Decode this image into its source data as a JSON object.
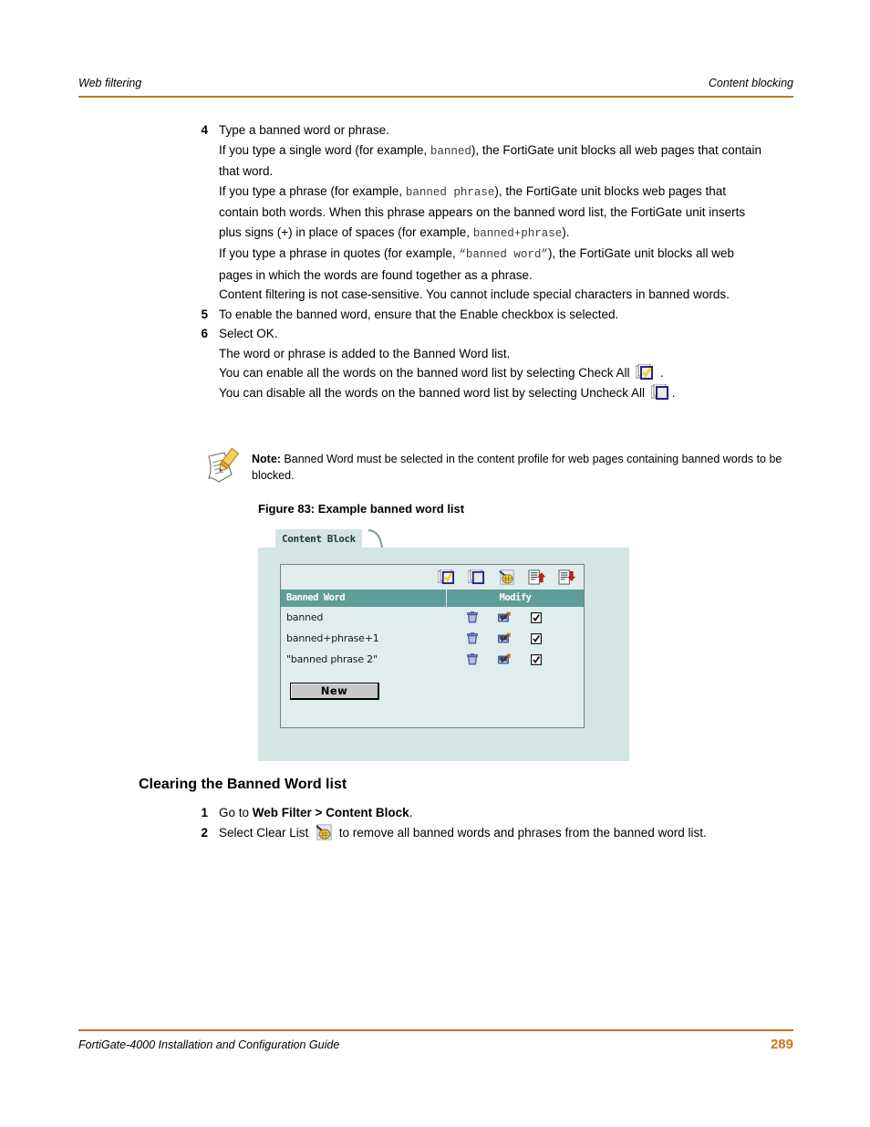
{
  "runhead": {
    "left": "Web filtering",
    "right": "Content blocking",
    "rule_color": "#c4781c"
  },
  "steps": [
    {
      "num": "4",
      "lines": [
        {
          "parts": [
            {
              "t": "Type a banned word or phrase.",
              "s": "plain"
            }
          ]
        },
        {
          "parts": [
            {
              "t": "If you type a single word (for example, ",
              "s": "plain"
            },
            {
              "t": "banned",
              "s": "mono"
            },
            {
              "t": "), the FortiGate unit blocks all web pages that contain that word.",
              "s": "plain"
            }
          ]
        },
        {
          "parts": [
            {
              "t": "If you type a phrase (for example, ",
              "s": "plain"
            },
            {
              "t": "banned phrase",
              "s": "mono"
            },
            {
              "t": "), the FortiGate unit blocks web pages that contain both words. When this phrase appears on the banned word list, the FortiGate unit inserts plus signs (+) in place of spaces (for example, ",
              "s": "plain"
            },
            {
              "t": "banned+phrase",
              "s": "mono"
            },
            {
              "t": ").",
              "s": "plain"
            }
          ]
        },
        {
          "parts": [
            {
              "t": "If you type a phrase in quotes (for example, ",
              "s": "plain"
            },
            {
              "t": "“banned word”",
              "s": "mono"
            },
            {
              "t": "), the FortiGate unit blocks all web pages in which the words are found together as a phrase.",
              "s": "plain"
            }
          ]
        },
        {
          "parts": [
            {
              "t": "Content filtering is not case-sensitive. You cannot include special characters in banned words.",
              "s": "plain"
            }
          ]
        }
      ]
    },
    {
      "num": "5",
      "lines": [
        {
          "parts": [
            {
              "t": "To enable the banned word, ensure that the Enable checkbox is selected.",
              "s": "plain"
            }
          ]
        }
      ]
    },
    {
      "num": "6",
      "lines": [
        {
          "parts": [
            {
              "t": "Select OK.",
              "s": "plain"
            }
          ]
        },
        {
          "parts": [
            {
              "t": "The word or phrase is added to the Banned Word list.",
              "s": "plain"
            }
          ]
        },
        {
          "parts": [
            {
              "t": "You can enable all the words on the banned word list by selecting Check All ",
              "s": "plain"
            },
            {
              "t": "",
              "s": "icon",
              "icon": "check-all-icon"
            },
            {
              "t": " .",
              "s": "plain"
            }
          ]
        },
        {
          "parts": [
            {
              "t": "You can disable all the words on the banned word list by selecting Uncheck All ",
              "s": "plain"
            },
            {
              "t": "",
              "s": "icon",
              "icon": "uncheck-all-icon"
            },
            {
              "t": ".",
              "s": "plain"
            }
          ]
        }
      ]
    }
  ],
  "note": {
    "icon": "note-pencil-icon",
    "label": "Note:",
    "text": " Banned Word must be selected in the content profile for web pages containing banned words to be blocked."
  },
  "figure": {
    "caption": "Figure 83: Example banned word list",
    "tab_label": "Content Block",
    "toolbar_icons": [
      "check-all-icon",
      "uncheck-all-icon",
      "clear-list-icon",
      "upload-list-icon",
      "download-list-icon"
    ],
    "columns": [
      "Banned Word",
      "Modify"
    ],
    "rows": [
      {
        "word": "banned",
        "actions": [
          "delete-icon",
          "edit-icon",
          "enable-checkbox"
        ],
        "enabled": true
      },
      {
        "word": "banned+phrase+1",
        "actions": [
          "delete-icon",
          "edit-icon",
          "enable-checkbox"
        ],
        "enabled": true
      },
      {
        "word": "\"banned phrase 2\"",
        "actions": [
          "delete-icon",
          "edit-icon",
          "enable-checkbox"
        ],
        "enabled": true
      }
    ],
    "new_button": "New",
    "colors": {
      "panel": "#d3e6e4",
      "inner": "#dfeeec",
      "header": "#5e9d99",
      "tab": "#d3e5e3"
    }
  },
  "section": {
    "heading": "Clearing the Banned Word list",
    "steps": [
      {
        "num": "1",
        "lines": [
          {
            "parts": [
              {
                "t": "Go to ",
                "s": "plain"
              },
              {
                "t": "Web Filter > Content Block",
                "s": "bold"
              },
              {
                "t": ".",
                "s": "plain"
              }
            ]
          }
        ]
      },
      {
        "num": "2",
        "lines": [
          {
            "parts": [
              {
                "t": "Select Clear List ",
                "s": "plain"
              },
              {
                "t": "",
                "s": "icon",
                "icon": "clear-list-icon"
              },
              {
                "t": " to remove all banned words and phrases from the banned word list.",
                "s": "plain"
              }
            ]
          }
        ]
      }
    ]
  },
  "footer": {
    "guide": "FortiGate-4000 Installation and Configuration Guide",
    "page": "289",
    "rule_color": "#c4781c",
    "page_color": "#c4781c"
  }
}
